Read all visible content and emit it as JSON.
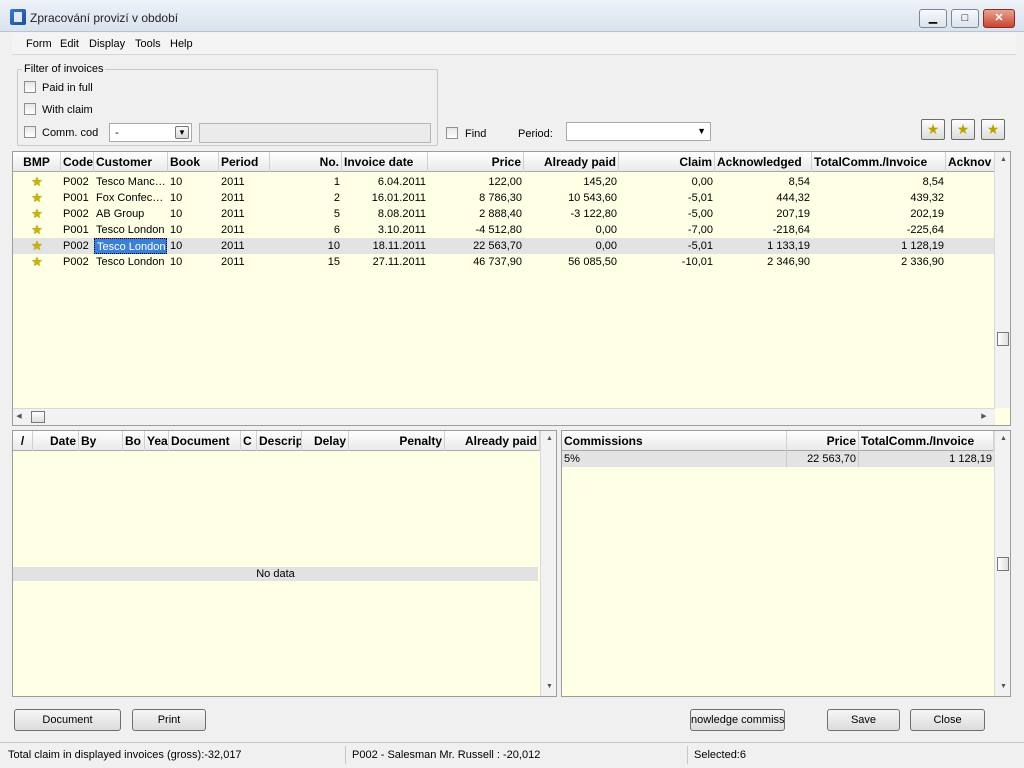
{
  "window": {
    "title": "Zpracování provizí v období"
  },
  "menu": [
    "Form",
    "Edit",
    "Display",
    "Tools",
    "Help"
  ],
  "filter": {
    "legend": "Filter of invoices",
    "paid_in_full": "Paid in full",
    "with_claim": "With claim",
    "comm_code": "Comm. cod",
    "comm_code_value": "-",
    "find": "Find",
    "period_label": "Period:",
    "period_value": ""
  },
  "invoices": {
    "columns": [
      "BMP",
      "Code",
      "Customer",
      "Book",
      "Period",
      "No.",
      "Invoice date",
      "Price",
      "Already paid",
      "Claim",
      "Acknowledged",
      "TotalComm./Invoice",
      "Acknov"
    ],
    "rows": [
      [
        "P002",
        "Tesco Manc…",
        "10",
        "2011",
        "1",
        "6.04.2011",
        "122,00",
        "145,20",
        "0,00",
        "8,54",
        "8,54"
      ],
      [
        "P001",
        "Fox Confec…",
        "10",
        "2011",
        "2",
        "16.01.2011",
        "8 786,30",
        "10 543,60",
        "-5,01",
        "444,32",
        "439,32"
      ],
      [
        "P002",
        "AB Group",
        "10",
        "2011",
        "5",
        "8.08.2011",
        "2 888,40",
        "-3 122,80",
        "-5,00",
        "207,19",
        "202,19"
      ],
      [
        "P001",
        "Tesco London",
        "10",
        "2011",
        "6",
        "3.10.2011",
        "-4 512,80",
        "0,00",
        "-7,00",
        "-218,64",
        "-225,64"
      ],
      [
        "P002",
        "Tesco London",
        "10",
        "2011",
        "10",
        "18.11.2011",
        "22 563,70",
        "0,00",
        "-5,01",
        "1 133,19",
        "1 128,19"
      ],
      [
        "P002",
        "Tesco London",
        "10",
        "2011",
        "15",
        "27.11.2011",
        "46 737,90",
        "56 085,50",
        "-10,01",
        "2 346,90",
        "2 336,90"
      ]
    ]
  },
  "payments": {
    "columns": [
      "/",
      "Date",
      "By",
      "Bo",
      "Yea",
      "Document",
      "C",
      "Descrip",
      "Delay",
      "Penalty",
      "Already paid"
    ],
    "no_data": "No data"
  },
  "commissions": {
    "columns": [
      "Commissions",
      "Price",
      "TotalComm./Invoice"
    ],
    "rows": [
      [
        "5%",
        "22 563,70",
        "1 128,19"
      ]
    ]
  },
  "buttons": {
    "document": "Document",
    "print": "Print",
    "acknowledge": "nowledge commissi",
    "save": "Save",
    "close": "Close"
  },
  "status": {
    "total_claim": "Total claim in displayed invoices (gross):-32,017",
    "salesman": "P002 - Salesman Mr. Russell : -20,012",
    "selected": "Selected:6"
  }
}
